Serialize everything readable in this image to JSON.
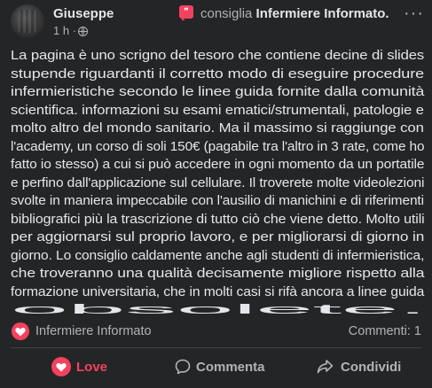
{
  "post": {
    "author": "Giuseppe",
    "recommend_verb": "consiglia",
    "recommended_page": "Infermiere Informato.",
    "time": "1 h",
    "time_separator": "·",
    "more_label": "···",
    "recommend_glyph": "❞",
    "text_lines": [
      "La pagina è uno scrigno del tesoro che contiene decine di slides",
      "stupende riguardanti il corretto modo di eseguire procedure",
      "infermieristiche secondo le linee guida fornite dalla comunità",
      "scientifica. informazioni su esami ematici/strumentali, patologie e",
      "molto altro del mondo sanitario. Ma il massimo si raggiunge con",
      "l'academy, un corso di soli 150€ (pagabile tra l'altro in 3 rate, come ho",
      "fatto io stesso) a cui si può accedere in ogni momento da un portatile",
      "e perfino dall'applicazione sul cellulare. Il troverete molte videolezioni",
      "svolte in maniera impeccabile con l'ausilio di manichini e di riferimenti",
      "bibliografici più la trascrizione di tutto ciò che viene detto. Molto utili",
      "per aggiornarsi sul proprio lavoro, e per migliorarsi di giorno in",
      "giorno. Lo consiglio caldamente anche agli studenti di infermieristica,",
      "che troveranno una qualità decisamente migliore rispetto alla",
      "formazione universitaria, che in molti casi si rifà ancora a linee guida",
      "obsolete."
    ]
  },
  "meta": {
    "page_name": "Infermiere Informato",
    "comments": "Commenti: 1"
  },
  "actions": {
    "love": "Love",
    "comment": "Commenta",
    "share": "Condividi"
  },
  "colors": {
    "background": "#242526",
    "text": "#e4e6eb",
    "secondary": "#b0b3b8",
    "love": "#f3425f"
  },
  "icons": [
    "avatar",
    "recommend-icon",
    "globe-icon",
    "more-icon",
    "heart-icon",
    "comment-icon",
    "share-icon"
  ]
}
